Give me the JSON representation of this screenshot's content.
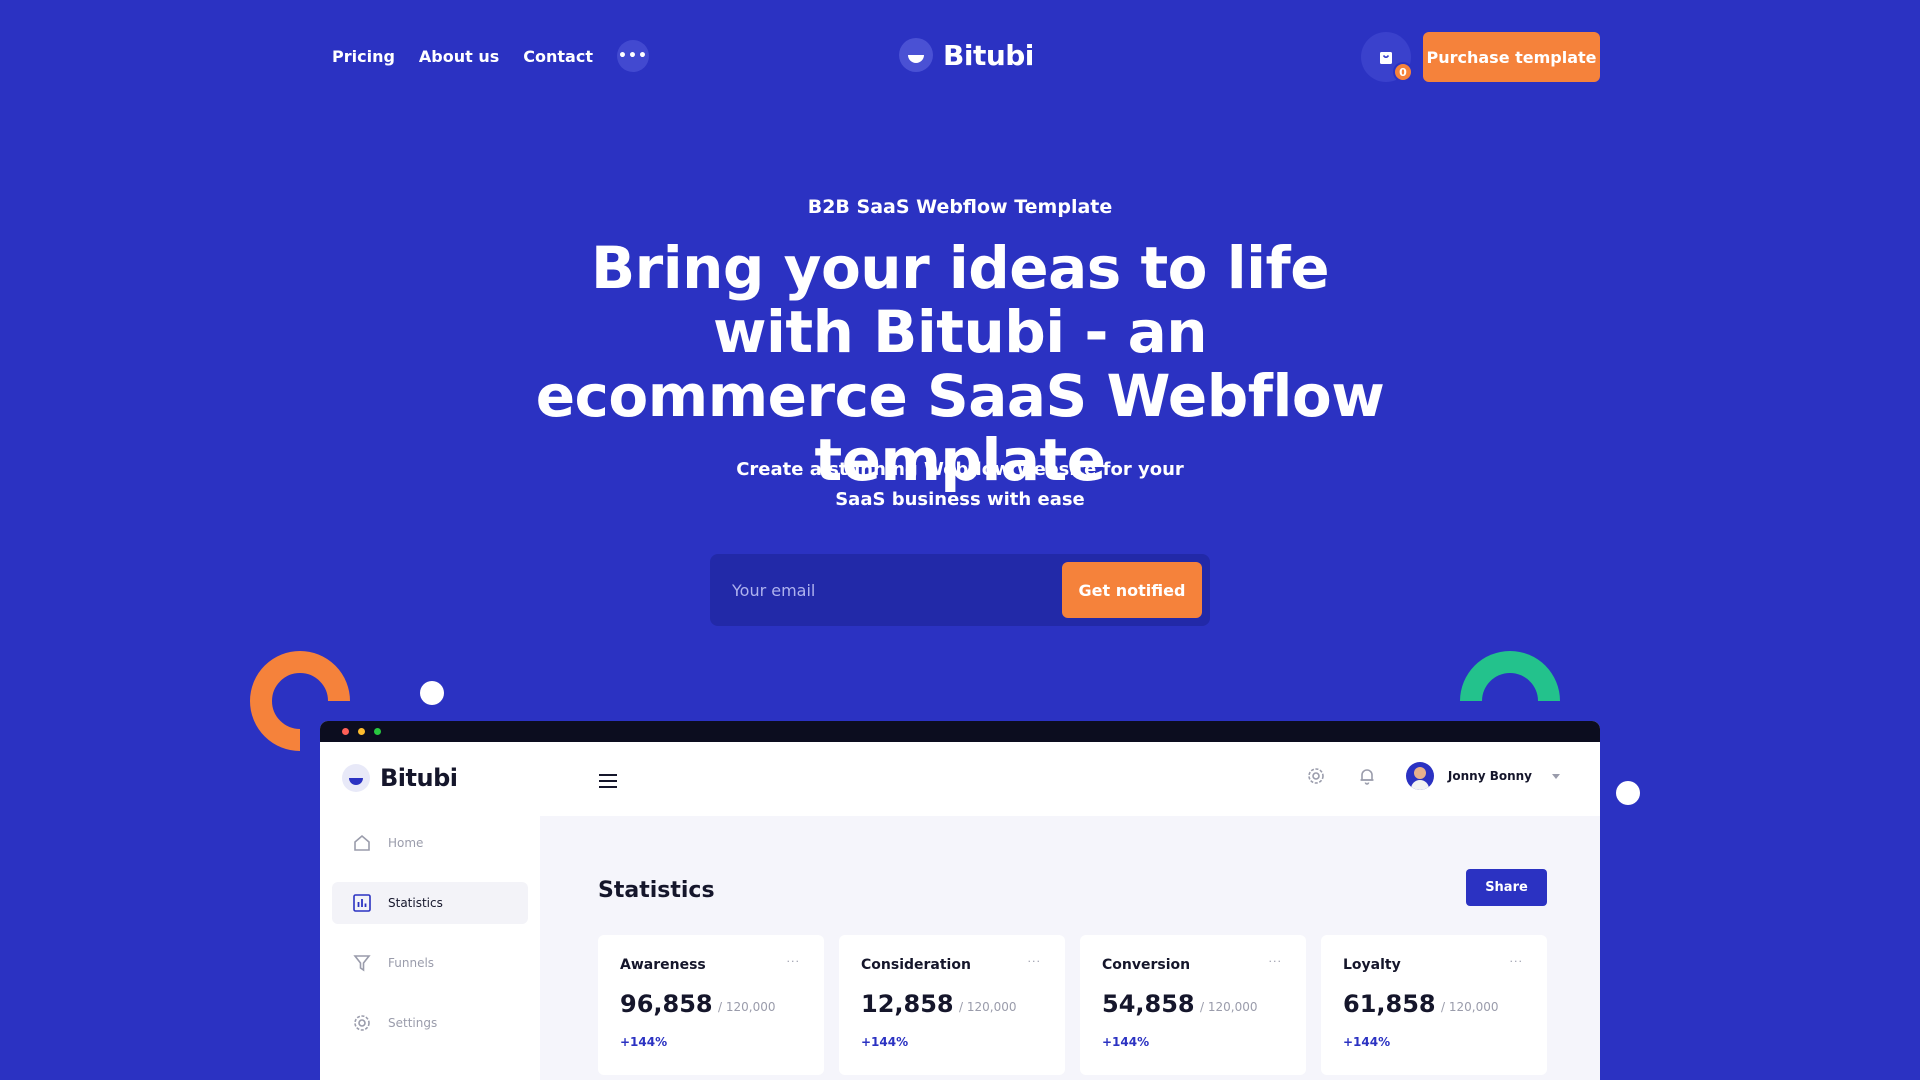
{
  "nav": {
    "links": [
      "Pricing",
      "About us",
      "Contact"
    ],
    "more_label": "•••",
    "brand": "Bitubi",
    "cart_count": "0",
    "purchase_label": "Purchase template"
  },
  "hero": {
    "eyebrow": "B2B SaaS Webflow Template",
    "headline": "Bring your ideas to life with Bitubi - an ecommerce SaaS Webflow template",
    "subline": "Create a stunning Webflow website for your SaaS business with ease",
    "email_placeholder": "Your email",
    "notify_label": "Get notified"
  },
  "dashboard": {
    "brand": "Bitubi",
    "sidebar": [
      {
        "label": "Home",
        "icon": "home-icon",
        "active": false
      },
      {
        "label": "Statistics",
        "icon": "bar-chart-icon",
        "active": true
      },
      {
        "label": "Funnels",
        "icon": "funnel-icon",
        "active": false
      },
      {
        "label": "Settings",
        "icon": "gear-icon",
        "active": false
      }
    ],
    "user_name": "Jonny Bonny",
    "page_title": "Statistics",
    "share_label": "Share",
    "cards": [
      {
        "title": "Awareness",
        "value": "96,858",
        "total": "/ 120,000",
        "change": "+144%"
      },
      {
        "title": "Consideration",
        "value": "12,858",
        "total": "/ 120,000",
        "change": "+144%"
      },
      {
        "title": "Conversion",
        "value": "54,858",
        "total": "/ 120,000",
        "change": "+144%"
      },
      {
        "title": "Loyalty",
        "value": "61,858",
        "total": "/ 120,000",
        "change": "+144%"
      }
    ],
    "card_menu_label": "···"
  },
  "colors": {
    "background": "#2b32c2",
    "accent_orange": "#f5823b",
    "accent_green": "#23c28c",
    "window_dots": [
      "#ff5f57",
      "#febc2e",
      "#28c840"
    ]
  }
}
